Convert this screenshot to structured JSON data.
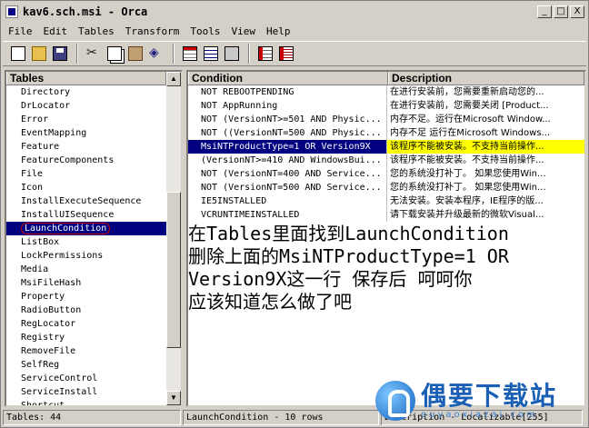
{
  "window": {
    "title": "kav6.sch.msi - Orca",
    "controls": [
      "_",
      "□",
      "X"
    ]
  },
  "menu": [
    "File",
    "Edit",
    "Tables",
    "Transform",
    "Tools",
    "View",
    "Help"
  ],
  "toolbar": [
    "new-icon",
    "open-icon",
    "save-icon",
    "cut-icon",
    "copy-icon",
    "paste-icon",
    "find-icon",
    "tables-icon",
    "rows-icon",
    "drop-icon",
    "add-row-icon",
    "delete-row-icon"
  ],
  "tables_pane": {
    "header": "Tables",
    "items": [
      "Directory",
      "DrLocator",
      "Error",
      "EventMapping",
      "Feature",
      "FeatureComponents",
      "File",
      "Icon",
      "InstallExecuteSequence",
      "InstallUISequence",
      "LaunchCondition",
      "ListBox",
      "LockPermissions",
      "Media",
      "MsiFileHash",
      "Property",
      "RadioButton",
      "RegLocator",
      "Registry",
      "RemoveFile",
      "SelfReg",
      "ServiceControl",
      "ServiceInstall",
      "Shortcut"
    ],
    "selected": "LaunchCondition"
  },
  "grid": {
    "columns": [
      "Condition",
      "Description"
    ],
    "rows": [
      [
        "NOT REBOOTPENDING",
        "在进行安装前，您需要重新启动您的..."
      ],
      [
        "NOT AppRunning",
        "在进行安装前，您需要关闭 [Product..."
      ],
      [
        "NOT (VersionNT>=501 AND Physic...",
        "内存不足。运行在Microsoft Window..."
      ],
      [
        "NOT ((VersionNT=500 AND Physic...",
        "内存不足 运行在Microsoft Windows..."
      ],
      [
        "MsiNTProductType=1 OR Version9X",
        "该程序不能被安装。不支持当前操作..."
      ],
      [
        "(VersionNT>=410 AND WindowsBui...",
        "该程序不能被安装。不支持当前操作..."
      ],
      [
        "NOT (VersionNT=400 AND Service...",
        "您的系统没打补丁。 如果您使用Win..."
      ],
      [
        "NOT (VersionNT=500 AND Service...",
        "您的系统没打补丁。 如果您使用Win..."
      ],
      [
        "IE5INSTALLED",
        "无法安装。安装本程序，IE程序的版..."
      ],
      [
        "VCRUNTIMEINSTALLED",
        "请下载安装并升级最新的微软Visual..."
      ]
    ],
    "selected_row": 4
  },
  "annotation": [
    "在Tables里面找到LaunchCondition",
    "删除上面的MsiNTProductType=1 OR",
    "Version9X这一行 保存后  呵呵你",
    "应该知道怎么做了吧"
  ],
  "status": [
    "Tables: 44",
    "LaunchCondition - 10 rows",
    "Description - Localizable[255]"
  ],
  "watermark": {
    "main": "偶要下载站",
    "sub": "ouyaoxiazai.com"
  }
}
